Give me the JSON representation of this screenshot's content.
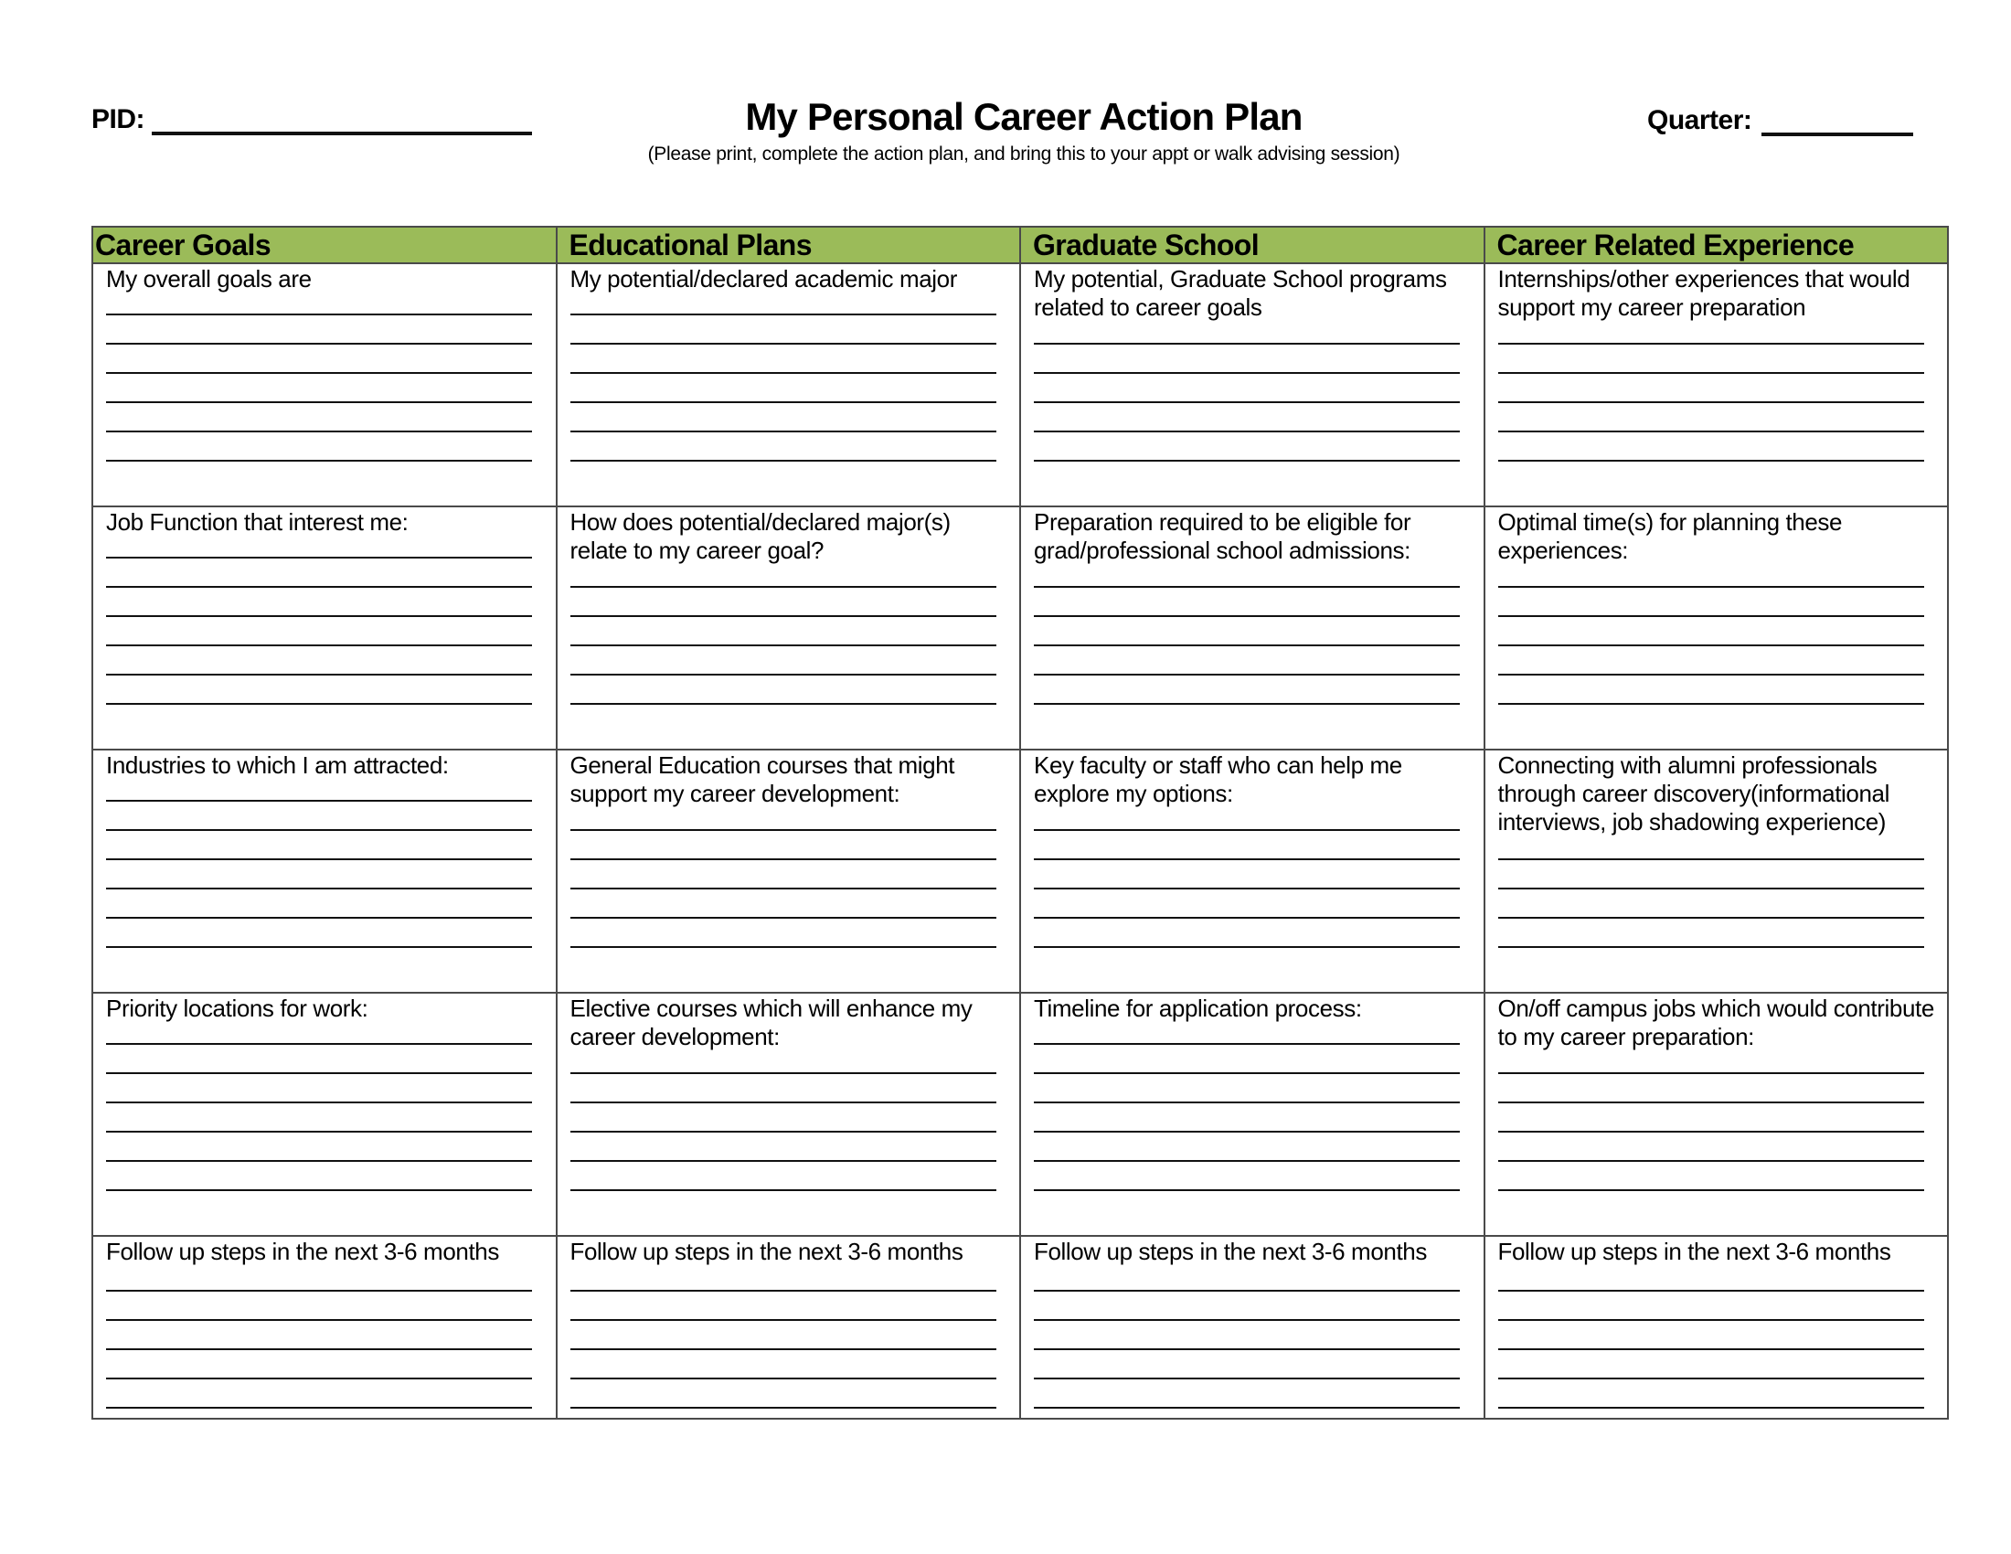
{
  "header": {
    "pid_label": "PID:",
    "title": "My Personal Career Action Plan",
    "subtitle": "(Please print, complete the action plan, and bring this to your appt or walk advising session)",
    "quarter_label": "Quarter:"
  },
  "colors": {
    "header_green": "#9bbb59",
    "border": "#4a4a4a"
  },
  "table": {
    "columns": [
      "Career Goals",
      "Educational Plans",
      "Graduate School",
      "Career Related Experience"
    ],
    "rows": [
      {
        "cells": [
          {
            "prompt": "My overall goals are",
            "lines": 6
          },
          {
            "prompt": "My potential/declared academic major",
            "lines": 6
          },
          {
            "prompt": "My potential, Graduate School programs related to career goals",
            "lines": 5
          },
          {
            "prompt": "Internships/other experiences that would support my career preparation",
            "lines": 5
          }
        ]
      },
      {
        "cells": [
          {
            "prompt": "Job Function that interest me:",
            "lines": 6
          },
          {
            "prompt": "How does potential/declared major(s) relate to my career goal?",
            "lines": 5
          },
          {
            "prompt": "Preparation required to be eligible for grad/professional school admissions:",
            "lines": 5
          },
          {
            "prompt": "Optimal time(s) for planning these experiences:",
            "lines": 5
          }
        ]
      },
      {
        "cells": [
          {
            "prompt": "Industries to which I am attracted:",
            "lines": 6
          },
          {
            "prompt": "General Education courses that might support my career development:",
            "lines": 5
          },
          {
            "prompt": "Key faculty or staff who can help me explore my options:",
            "lines": 5
          },
          {
            "prompt": "Connecting with alumni professionals through career discovery(informational interviews, job shadowing experience)",
            "lines": 4
          }
        ]
      },
      {
        "cells": [
          {
            "prompt": "Priority locations for work:",
            "lines": 6
          },
          {
            "prompt": "Elective courses which will enhance my career development:",
            "lines": 5
          },
          {
            "prompt": "Timeline for application process:",
            "lines": 6
          },
          {
            "prompt": "On/off campus jobs which would contribute to my career preparation:",
            "lines": 5
          }
        ]
      },
      {
        "cells": [
          {
            "prompt": "Follow up steps in the next 3-6 months",
            "lines": 5
          },
          {
            "prompt": "Follow up steps in the next 3-6 months",
            "lines": 5
          },
          {
            "prompt": "Follow up steps in the next 3-6 months",
            "lines": 5
          },
          {
            "prompt": "Follow up steps in the next 3-6 months",
            "lines": 5
          }
        ]
      }
    ]
  }
}
